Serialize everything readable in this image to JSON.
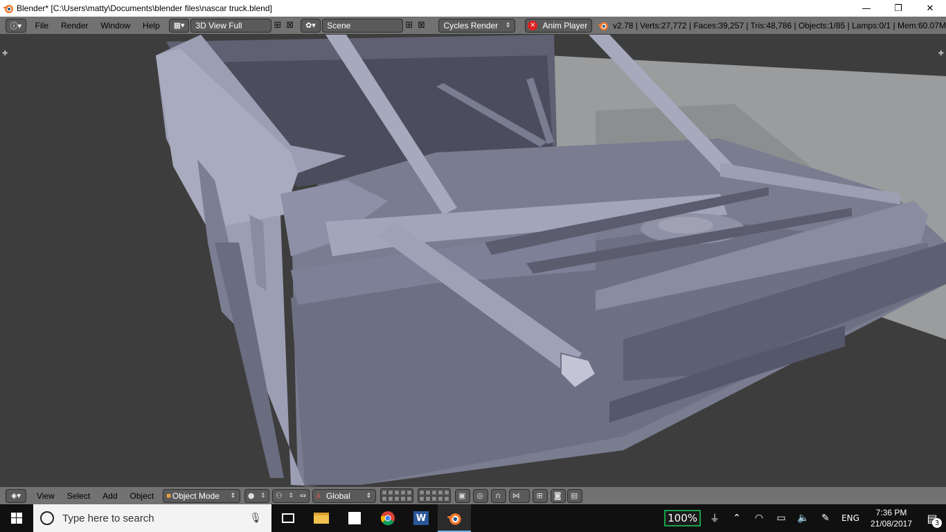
{
  "window": {
    "title": "Blender* [C:\\Users\\matty\\Documents\\blender files\\nascar truck.blend]",
    "minimize_glyph": "—",
    "restore_glyph": "❐",
    "close_glyph": "✕"
  },
  "info_header": {
    "menus": [
      "File",
      "Render",
      "Window",
      "Help"
    ],
    "screen_layout": "3D View Full",
    "scene": "Scene",
    "render_engine": "Cycles Render",
    "anim_player": "Anim Player",
    "stats": "v2.78 | Verts:27,772 | Faces:39,257 | Tris:48,786 | Objects:1/85 | Lamps:0/1 | Mem:60.07M"
  },
  "view_header": {
    "menus": [
      "View",
      "Select",
      "Add",
      "Object"
    ],
    "mode": "Object Mode",
    "orientation": "Global"
  },
  "taskbar": {
    "search_placeholder": "Type here to search",
    "battery": "100%",
    "language": "ENG",
    "time": "7:36 PM",
    "date": "21/08/2017",
    "notifications": "3"
  },
  "colors": {
    "blender_header": "#727272",
    "viewport_bg": "#3d3d3d",
    "mesh": "#8e90a8",
    "taskbar": "#101010",
    "battery_border": "#16a34a"
  }
}
